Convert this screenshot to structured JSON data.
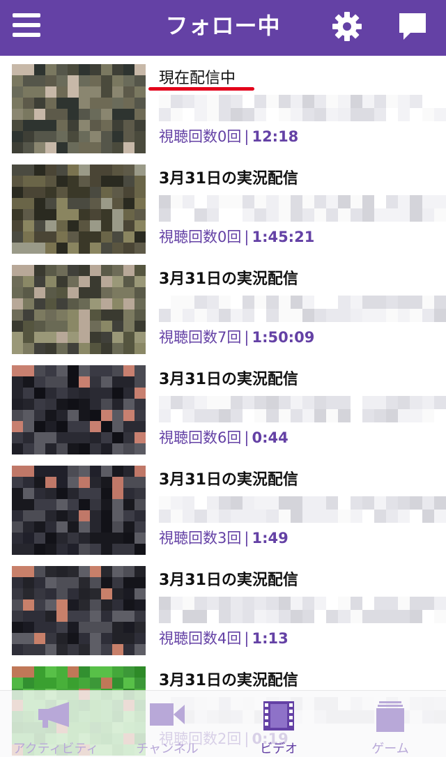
{
  "header": {
    "title": "フォロー中",
    "menu_icon": "hamburger-icon",
    "settings_icon": "gear-icon",
    "chat_icon": "chat-bubble-icon",
    "background": "#6441a5"
  },
  "videos": [
    {
      "title": "現在配信中",
      "views": "視聴回数0回",
      "duration": "12:18",
      "live": true
    },
    {
      "title": "3月31日の実況配信",
      "views": "視聴回数0回",
      "duration": "1:45:21",
      "live": false
    },
    {
      "title": "3月31日の実況配信",
      "views": "視聴回数7回",
      "duration": "1:50:09",
      "live": false
    },
    {
      "title": "3月31日の実況配信",
      "views": "視聴回数6回",
      "duration": "0:44",
      "live": false
    },
    {
      "title": "3月31日の実況配信",
      "views": "視聴回数3回",
      "duration": "1:49",
      "live": false
    },
    {
      "title": "3月31日の実況配信",
      "views": "視聴回数4回",
      "duration": "1:13",
      "live": false
    },
    {
      "title": "3月31日の実況配信",
      "views": "視聴回数2回",
      "duration": "0:19",
      "live": false
    }
  ],
  "tabs": [
    {
      "label": "アクティビティ",
      "icon": "megaphone-icon",
      "active": false
    },
    {
      "label": "チャンネル",
      "icon": "video-camera-icon",
      "active": false
    },
    {
      "label": "ビデオ",
      "icon": "film-strip-icon",
      "active": true
    },
    {
      "label": "ゲーム",
      "icon": "game-stack-icon",
      "active": false
    }
  ],
  "colors": {
    "accent": "#6441a5",
    "live_underline": "#e3001b",
    "tab_inactive": "#b8a8d8"
  }
}
